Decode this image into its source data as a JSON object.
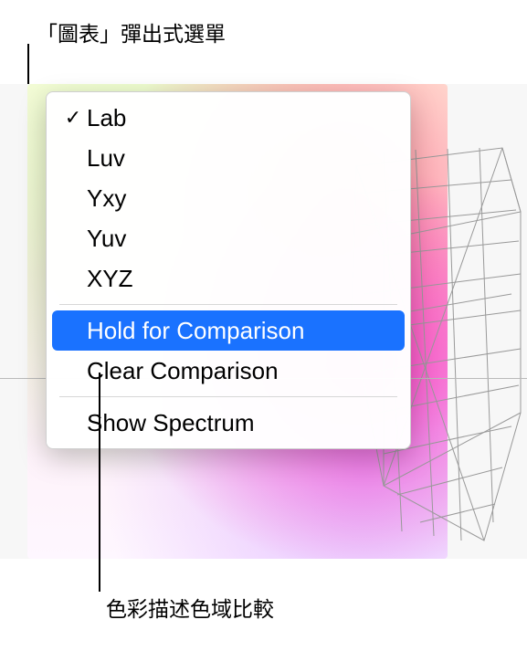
{
  "callouts": {
    "top": "「圖表」彈出式選單",
    "bottom": "色彩描述色域比較"
  },
  "menu": {
    "items": [
      {
        "label": "Lab",
        "checked": true
      },
      {
        "label": "Luv",
        "checked": false
      },
      {
        "label": "Yxy",
        "checked": false
      },
      {
        "label": "Yuv",
        "checked": false
      },
      {
        "label": "XYZ",
        "checked": false
      }
    ],
    "comparison": {
      "hold": "Hold for Comparison",
      "clear": "Clear Comparison"
    },
    "spectrum": "Show Spectrum",
    "highlighted": "hold"
  },
  "icons": {
    "check": "✓"
  }
}
